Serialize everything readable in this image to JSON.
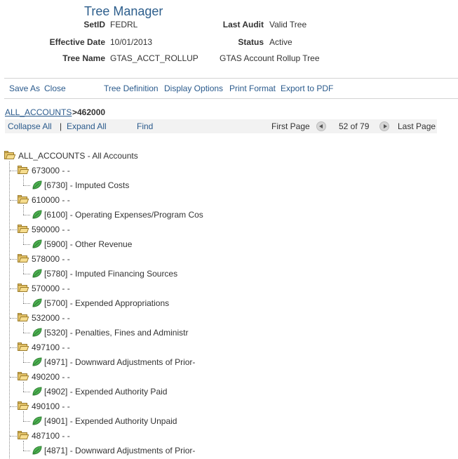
{
  "header": {
    "title": "Tree Manager",
    "setid_label": "SetID",
    "setid": "FEDRL",
    "last_audit_label": "Last Audit",
    "last_audit": "Valid Tree",
    "effective_date_label": "Effective Date",
    "effective_date": "10/01/2013",
    "status_label": "Status",
    "status": "Active",
    "tree_name_label": "Tree Name",
    "tree_name": "GTAS_ACCT_ROLLUP",
    "tree_desc": "GTAS Account Rollup Tree"
  },
  "toolbar": {
    "save_as": "Save As",
    "close": "Close",
    "tree_definition": "Tree Definition",
    "display_options": "Display Options",
    "print_format": "Print Format",
    "export_pdf": "Export to PDF"
  },
  "breadcrumb": {
    "root": "ALL_ACCOUNTS",
    "current": ">462000"
  },
  "nav": {
    "collapse_all": "Collapse All",
    "separator": "|",
    "expand_all": "Expand All",
    "find": "Find",
    "first_page": "First Page",
    "page_info": "52 of 79",
    "last_page": "Last Page"
  },
  "tree": {
    "root": "ALL_ACCOUNTS - All Accounts",
    "nodes": [
      {
        "node": "673000 - -",
        "leaf": "[6730] - Imputed Costs"
      },
      {
        "node": "610000 - -",
        "leaf": "[6100] - Operating Expenses/Program Cos"
      },
      {
        "node": "590000 - -",
        "leaf": "[5900] - Other Revenue"
      },
      {
        "node": "578000 - -",
        "leaf": "[5780] - Imputed Financing Sources"
      },
      {
        "node": "570000 - -",
        "leaf": "[5700] - Expended Appropriations"
      },
      {
        "node": "532000 - -",
        "leaf": "[5320] - Penalties, Fines and Administr"
      },
      {
        "node": "497100 - -",
        "leaf": "[4971] - Downward Adjustments of Prior-"
      },
      {
        "node": "490200 - -",
        "leaf": "[4902] - Expended Authority Paid"
      },
      {
        "node": "490100 - -",
        "leaf": "[4901] - Expended Authority Unpaid"
      },
      {
        "node": "487100 - -",
        "leaf": "[4871] - Downward Adjustments of Prior-"
      }
    ]
  },
  "colors": {
    "link": "#2a5a8c",
    "title": "#2d5e8c",
    "leaf_icon": "#3a9a3a",
    "folder_icon": "#e6c56a"
  }
}
